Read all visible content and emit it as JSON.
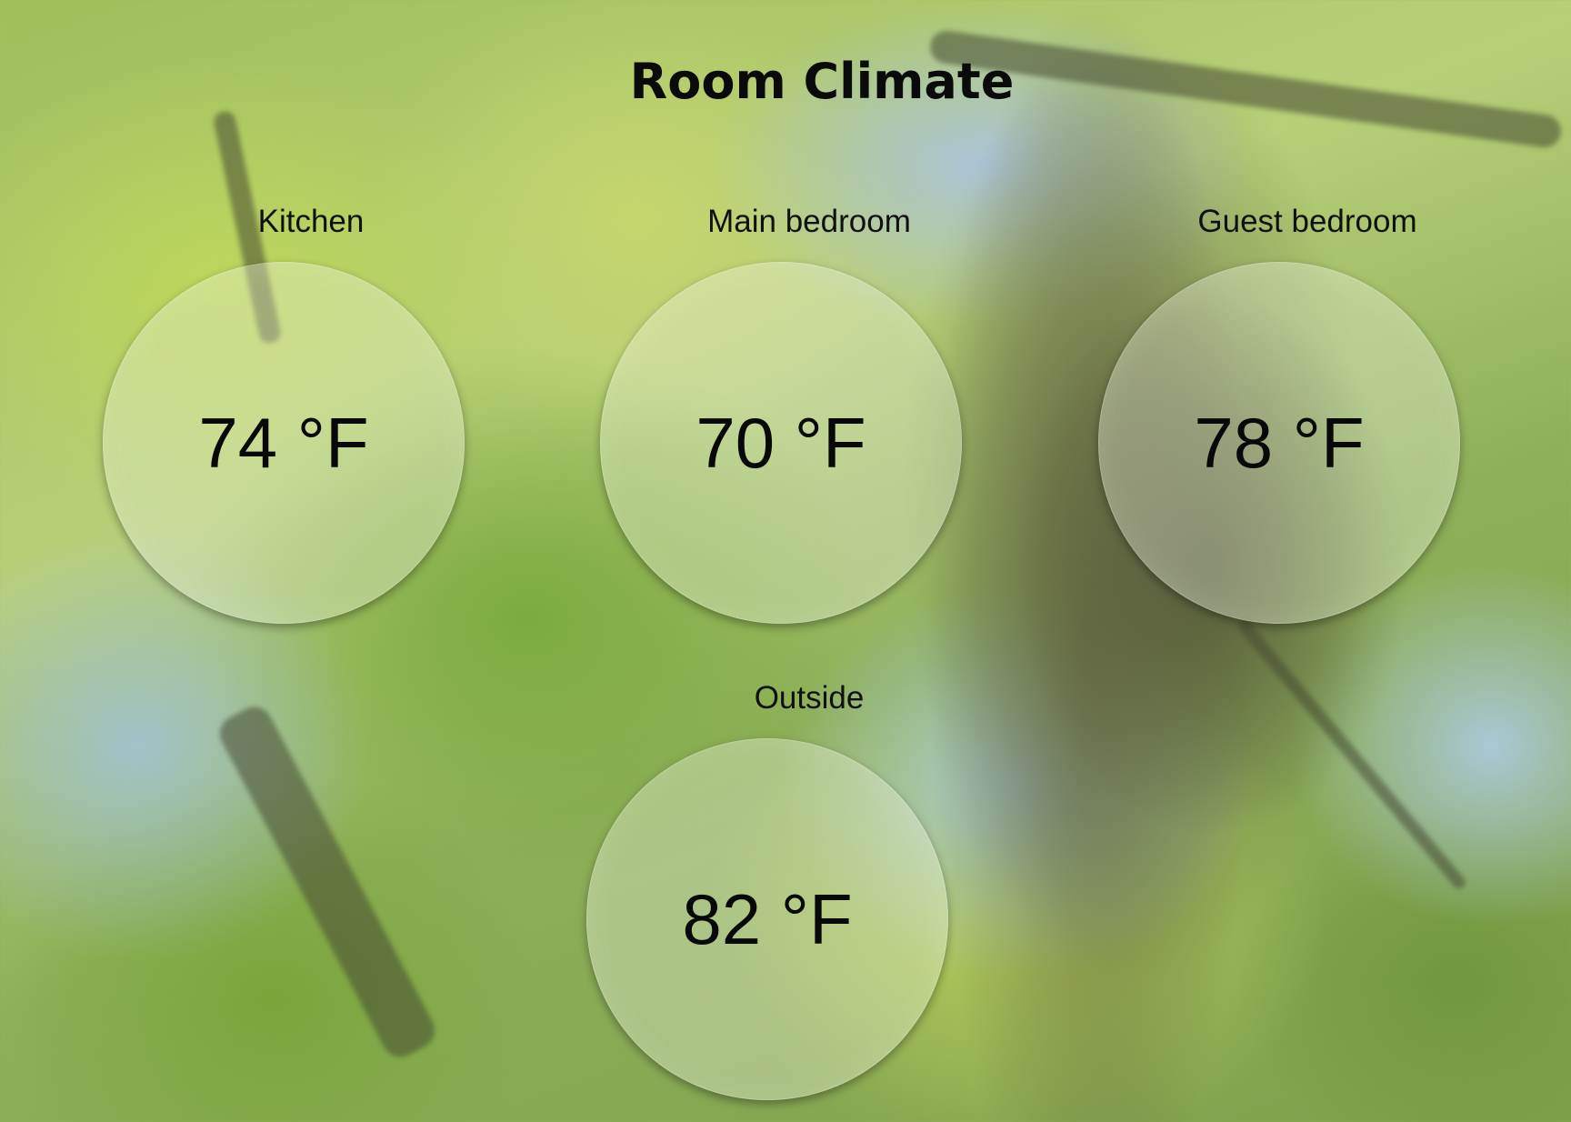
{
  "page": {
    "title": "Room Climate"
  },
  "rooms": [
    {
      "name": "Kitchen",
      "temperature": "74 °F"
    },
    {
      "name": "Main bedroom",
      "temperature": "70 °F"
    },
    {
      "name": "Guest bedroom",
      "temperature": "78 °F"
    },
    {
      "name": "Outside",
      "temperature": "82 °F"
    }
  ]
}
